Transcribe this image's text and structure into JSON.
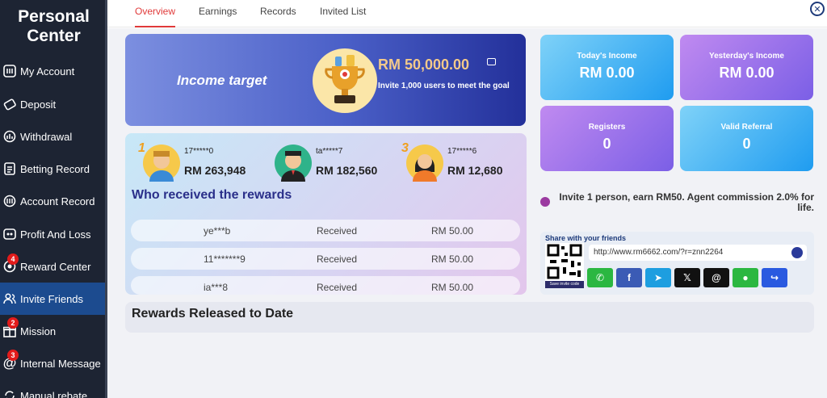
{
  "sidebar": {
    "title_line1": "Personal",
    "title_line2": "Center",
    "items": [
      {
        "label": "My Account"
      },
      {
        "label": "Deposit"
      },
      {
        "label": "Withdrawal"
      },
      {
        "label": "Betting Record"
      },
      {
        "label": "Account Record"
      },
      {
        "label": "Profit And Loss"
      },
      {
        "label": "Reward Center",
        "badge": "4"
      },
      {
        "label": "Invite Friends"
      },
      {
        "label": "Mission",
        "badge": "2"
      },
      {
        "label": "Internal Message",
        "badge": "3"
      },
      {
        "label": "Manual rebate"
      }
    ]
  },
  "tabs": [
    "Overview",
    "Earnings",
    "Records",
    "Invited List"
  ],
  "income_target": {
    "label": "Income target",
    "amount": "RM  50,000.00",
    "subtitle": "Invite 1,000 users to meet the goal"
  },
  "ranking": [
    {
      "name": "17*****0",
      "score": "RM  263,948",
      "medal": "1"
    },
    {
      "name": "ta*****7",
      "score": "RM  182,560",
      "medal": ""
    },
    {
      "name": "17*****6",
      "score": "RM  12,680",
      "medal": "3"
    }
  ],
  "rewards_heading": "Who received the rewards",
  "reward_rows": [
    {
      "user": "ye***b",
      "status": "Received",
      "amount": "RM  50.00"
    },
    {
      "user": "11*******9",
      "status": "Received",
      "amount": "RM  50.00"
    },
    {
      "user": "ia***8",
      "status": "Received",
      "amount": "RM  50.00"
    }
  ],
  "stats": {
    "today_income": {
      "label": "Today's Income",
      "value": "RM  0.00"
    },
    "yesterday_income": {
      "label": "Yesterday's Income",
      "value": "RM  0.00"
    },
    "registers": {
      "label": "Registers",
      "value": "0"
    },
    "valid_referral": {
      "label": "Valid Referral",
      "value": "0"
    }
  },
  "invite_text": "Invite 1 person, earn RM50. Agent commission 2.0% for life.",
  "share": {
    "title": "Share with your friends",
    "url": "http://www.rm6662.com/?r=znn2264",
    "save_qr": "Save invite code"
  },
  "released_heading": "Rewards Released to Date",
  "colors": {
    "sidebar": "#1d2433",
    "active": "#1c4b8f",
    "tab_active": "#e03a3a"
  }
}
